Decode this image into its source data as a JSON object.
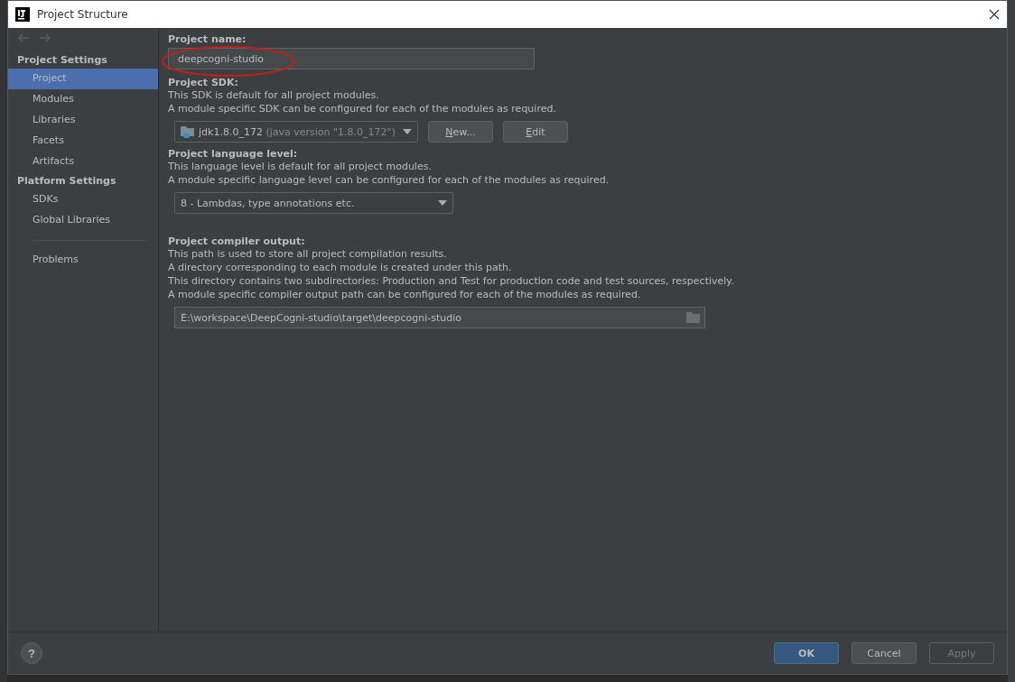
{
  "window": {
    "title": "Project Structure"
  },
  "sidebar": {
    "sections": [
      {
        "title": "Project Settings",
        "items": [
          {
            "label": "Project",
            "selected": true
          },
          {
            "label": "Modules",
            "selected": false
          },
          {
            "label": "Libraries",
            "selected": false
          },
          {
            "label": "Facets",
            "selected": false
          },
          {
            "label": "Artifacts",
            "selected": false
          }
        ]
      },
      {
        "title": "Platform Settings",
        "items": [
          {
            "label": "SDKs",
            "selected": false
          },
          {
            "label": "Global Libraries",
            "selected": false
          }
        ]
      }
    ],
    "extra_items": [
      {
        "label": "Problems",
        "selected": false
      }
    ]
  },
  "project_name": {
    "label": "Project name:",
    "value": "deepcogni-studio",
    "highlighted": true
  },
  "project_sdk": {
    "label": "Project SDK:",
    "lines": [
      "This SDK is default for all project modules.",
      "A module specific SDK can be configured for each of the modules as required."
    ],
    "sdk": "jdk1.8.0_172",
    "version": "(java version \"1.8.0_172\")",
    "buttons": [
      {
        "mnemonic": "N",
        "rest": "ew..."
      },
      {
        "mnemonic": "E",
        "rest": "dit"
      }
    ]
  },
  "language_level": {
    "label": "Project language level:",
    "lines": [
      "This language level is default for all project modules.",
      "A module specific language level can be configured for each of the modules as required."
    ],
    "value": "8 - Lambdas, type annotations etc."
  },
  "compiler_output": {
    "label": "Project compiler output:",
    "lines": [
      "This path is used to store all project compilation results.",
      "A directory corresponding to each module is created under this path.",
      "This directory contains two subdirectories: Production and Test for production code and test sources, respectively.",
      "A module specific compiler output path can be configured for each of the modules as required."
    ],
    "value": "E:\\workspace\\DeepCogni-studio\\target\\deepcogni-studio"
  },
  "footer": {
    "help": "?",
    "buttons": [
      {
        "label": "OK",
        "kind": "primary",
        "disabled": false
      },
      {
        "label": "Cancel",
        "kind": "normal",
        "disabled": false
      },
      {
        "label": "Apply",
        "kind": "normal",
        "disabled": true
      }
    ]
  }
}
